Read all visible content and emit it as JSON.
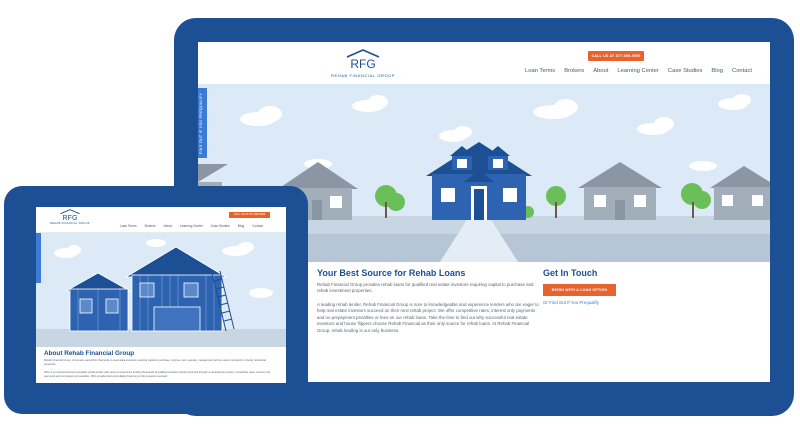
{
  "brand": {
    "logo_text": "RFG",
    "logo_subtitle": "REHAB FINANCIAL GROUP",
    "primary_color": "#1d4f94",
    "accent_color": "#e8622e",
    "link_color": "#3b7bd3"
  },
  "large_tablet": {
    "header": {
      "call_cta": "CALL US AT 877-999-9999",
      "nav": [
        "Loan Terms",
        "Brokers",
        "About",
        "Learning Center",
        "Case Studies",
        "Blog",
        "Contact"
      ]
    },
    "side_tab": "FIND OUT IF YOU PREQUALIFY",
    "hero": {
      "illustration": "street-of-houses-with-blue-house-center"
    },
    "main": {
      "heading": "Your Best Source for Rehab Loans",
      "lead": "Rehab Financial Group provides rehab loans for qualified real estate investors requiring capital to purchase and rehab investment properties.",
      "body": "A leading rehab lender, Rehab Financial Group is sure to knowledgeable and experience lenders who are eager to help real estate investors succeed on their next rehab project. We offer competitive rates, interest only payments and no prepayment penalties or fees on our rehab loans. Take the time to find out why successful real estate investors and house flippers choose Rehab Financial as their only source for rehab loans. At Rehab Financial Group, rehab lending is our only business."
    },
    "aside": {
      "heading": "Get In Touch",
      "loan_button": "BEGIN WITH A LOAN OPTION",
      "qualify_link": "Or Find Out If You Prequalify"
    }
  },
  "small_tablet": {
    "header": {
      "call_cta": "CALL US AT 877-999-9999",
      "nav": [
        "Loan Terms",
        "Brokers",
        "About",
        "Learning Center",
        "Case Studies",
        "Blog",
        "Contact"
      ]
    },
    "hero": {
      "illustration": "house-under-construction-with-ladder"
    },
    "about": {
      "heading": "About Rehab Financial Group",
      "p1": "Rehab Financial Group, of investor-owned firm that lends to real estate investors requiring capital to purchase, improve, own, operate, manage and sell non-owner occupied 1-4 family residential properties.",
      "p2": "RFG is an experienced and reputable private lender with years of experience funding thousands of qualified investors rehab properties through a streamlined process, competitive rates, interest only payments and no prepayment penalties. RFG provides fast and reliable financing to help investors succeed."
    }
  }
}
